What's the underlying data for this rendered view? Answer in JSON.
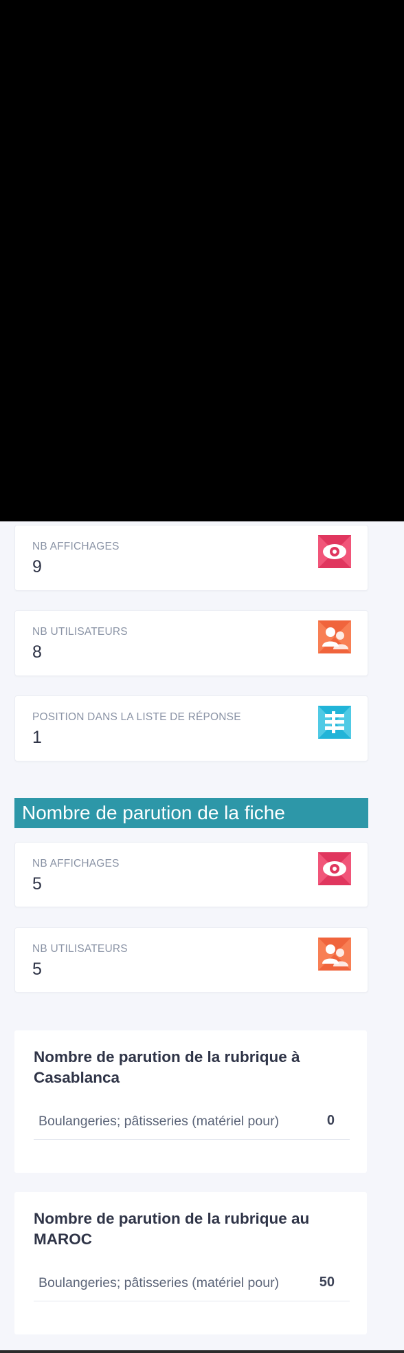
{
  "stats_group_1": [
    {
      "label": "NB AFFICHAGES",
      "value": "9",
      "icon": "eye-icon",
      "color": "#e0365e"
    },
    {
      "label": "NB UTILISATEURS",
      "value": "8",
      "icon": "users-icon",
      "color": "#f0643c"
    },
    {
      "label": "POSITION DANS LA LISTE DE RÉPONSE",
      "value": "1",
      "icon": "list-icon",
      "color": "#21b4d8"
    }
  ],
  "section_title": "Nombre de parution de la fiche",
  "stats_group_2": [
    {
      "label": "NB AFFICHAGES",
      "value": "5",
      "icon": "eye-icon",
      "color": "#e0365e"
    },
    {
      "label": "NB UTILISATEURS",
      "value": "5",
      "icon": "users-icon",
      "color": "#f0643c"
    }
  ],
  "rubrique_city": {
    "title": "Nombre de parution de la rubrique à Casablanca",
    "rows": [
      {
        "name": "Boulangeries; pâtisseries (matériel pour)",
        "count": "0"
      }
    ]
  },
  "rubrique_country": {
    "title": "Nombre de parution de la rubrique au MAROC",
    "rows": [
      {
        "name": "Boulangeries; pâtisseries (matériel pour)",
        "count": "50"
      }
    ]
  },
  "colors": {
    "accent_teal": "#2d97a8",
    "pink": "#e0365e",
    "orange": "#f0643c",
    "cyan": "#21b4d8"
  }
}
